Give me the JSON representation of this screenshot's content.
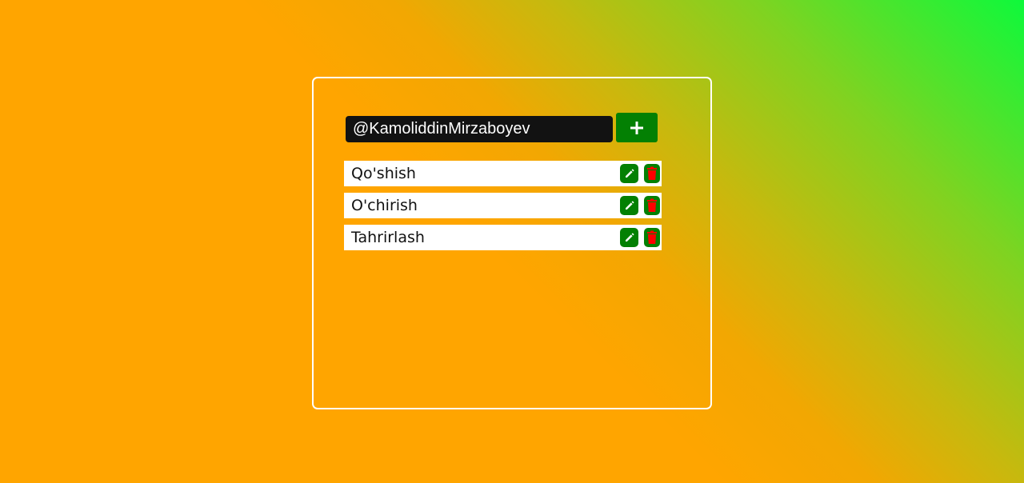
{
  "input": {
    "value": "@KamoliddinMirzaboyev",
    "add_icon": "plus-icon"
  },
  "tasks": [
    {
      "text": "Qo'shish",
      "edit_icon": "pencil-icon",
      "delete_icon": "trash-icon"
    },
    {
      "text": "O'chirish",
      "edit_icon": "pencil-icon",
      "delete_icon": "trash-icon"
    },
    {
      "text": "Tahrirlash",
      "edit_icon": "pencil-icon",
      "delete_icon": "trash-icon"
    }
  ],
  "colors": {
    "button_green": "#038003",
    "delete_red": "#ff0000",
    "input_bg": "#121212",
    "background_orange": "#ffa500",
    "background_green": "#0ef93b"
  }
}
